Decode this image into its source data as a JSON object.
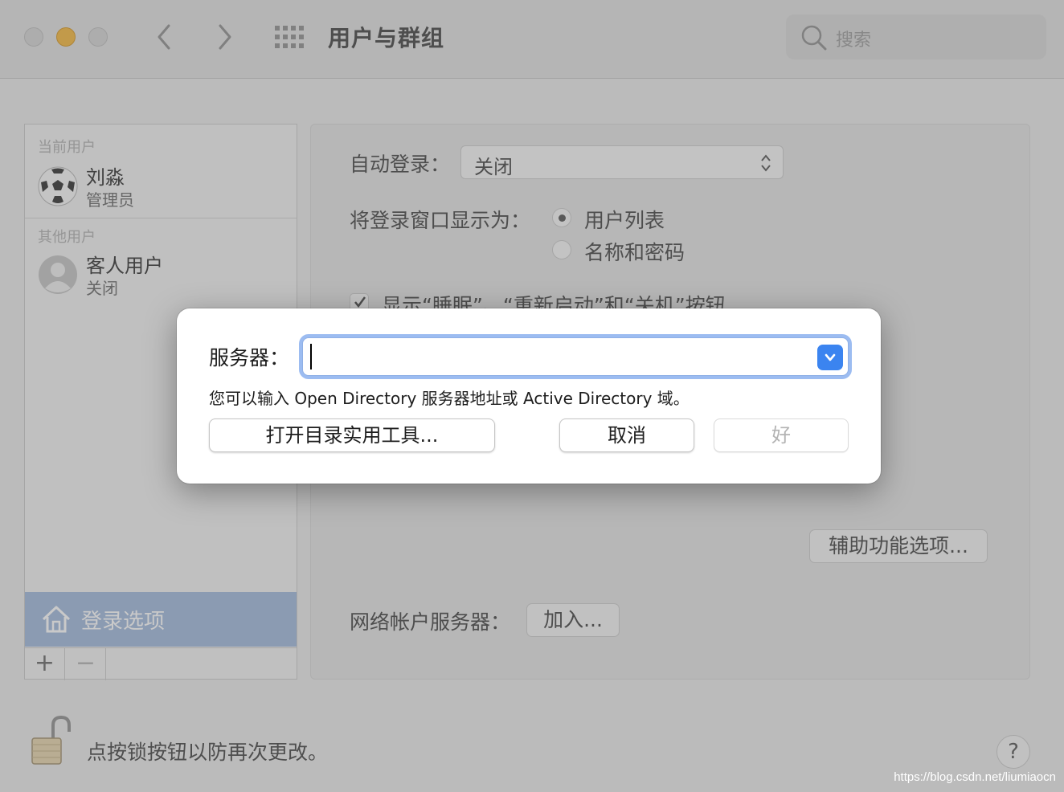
{
  "window": {
    "title": "用户与群组",
    "search_placeholder": "搜索"
  },
  "sidebar": {
    "current_users_header": "当前用户",
    "current_user": {
      "name": "刘淼",
      "role": "管理员"
    },
    "other_users_header": "其他用户",
    "other_user": {
      "name": "客人用户",
      "status": "关闭"
    },
    "login_options_label": "登录选项",
    "add_label": "+",
    "remove_label": "−"
  },
  "main": {
    "auto_login_label": "自动登录：",
    "auto_login_value": "关闭",
    "login_window_label": "将登录窗口显示为：",
    "radio_options": [
      "用户列表",
      "名称和密码"
    ],
    "show_buttons_label": "显示“睡眠”、“重新启动”和“关机”按钮",
    "accessibility_button": "辅助功能选项...",
    "network_server_label": "网络帐户服务器：",
    "join_button": "加入..."
  },
  "footer": {
    "lock_text": "点按锁按钮以防再次更改。",
    "help_label": "?"
  },
  "dialog": {
    "server_label": "服务器：",
    "server_value": "",
    "hint": "您可以输入 Open Directory 服务器地址或 Active Directory 域。",
    "open_utility_button": "打开目录实用工具...",
    "cancel_button": "取消",
    "ok_button": "好"
  },
  "watermark": "https://blog.csdn.net/liumiaocn",
  "colors": {
    "accent": "#3b84f0",
    "focus_ring": "#9cbcf1",
    "selection": "#a9bfe0",
    "minimize": "#f6be4f"
  }
}
